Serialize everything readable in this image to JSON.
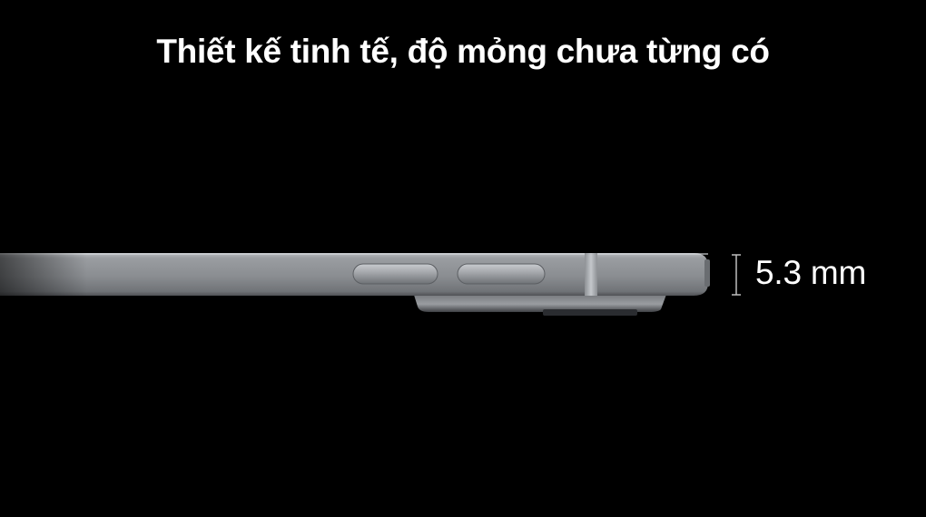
{
  "headline": "Thiết kế tinh tế, độ mỏng chưa từng có",
  "thickness": "5.3 mm",
  "colors": {
    "background": "#000000",
    "text": "#ffffff",
    "device_frame": "#8a8d91",
    "device_highlight": "#c3c6ca",
    "device_shadow": "#4a4c50"
  }
}
